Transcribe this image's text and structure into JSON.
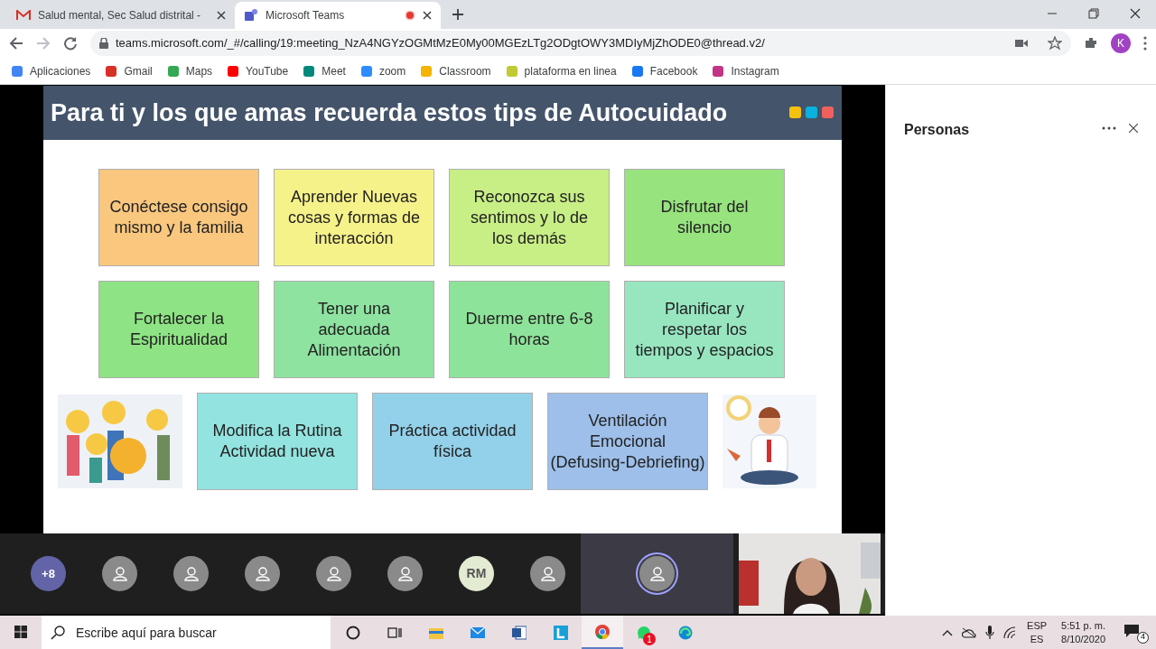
{
  "tabs": [
    {
      "title": "Salud mental, Sec Salud distrital -",
      "selected": false,
      "recording": false
    },
    {
      "title": "Microsoft Teams",
      "selected": true,
      "recording": true
    }
  ],
  "url": "teams.microsoft.com/_#/calling/19:meeting_NzA4NGYzOGMtMzE0My00MGEzLTg2ODgtOWY3MDIyMjZhODE0@thread.v2/",
  "profile": "K",
  "bookmarks": [
    {
      "label": "Aplicaciones",
      "color": "#4285f4"
    },
    {
      "label": "Gmail",
      "color": "#d93025"
    },
    {
      "label": "Maps",
      "color": "#34a853"
    },
    {
      "label": "YouTube",
      "color": "#ff0000"
    },
    {
      "label": "Meet",
      "color": "#00897b"
    },
    {
      "label": "zoom",
      "color": "#2d8cff"
    },
    {
      "label": "Classroom",
      "color": "#f4b400"
    },
    {
      "label": "plataforma en linea",
      "color": "#c0ca33"
    },
    {
      "label": "Facebook",
      "color": "#1877f2"
    },
    {
      "label": "Instagram",
      "color": "#c13584"
    }
  ],
  "slide": {
    "title": "Para ti y los que amas recuerda estos tips de Autocuidado",
    "rows": [
      [
        {
          "kind": "tip",
          "text": "Conéctese consigo\nmismo y  la familia",
          "color": "#f9c77e"
        },
        {
          "kind": "tip",
          "text": "Aprender Nuevas\ncosas y formas de\ninteracción",
          "color": "#f6f28a"
        },
        {
          "kind": "tip",
          "text": "Reconozca  sus\nsentimos y lo de\nlos demás",
          "color": "#c8ee86"
        },
        {
          "kind": "tip",
          "text": "Disfrutar del\nsilencio",
          "color": "#97e37e"
        }
      ],
      [
        {
          "kind": "tip",
          "text": "Fortalecer la\nEspiritualidad",
          "color": "#8ee384"
        },
        {
          "kind": "tip",
          "text": "Tener una\nadecuada\nAlimentación",
          "color": "#8ee3a0"
        },
        {
          "kind": "tip",
          "text": "Duerme entre 6-8\nhoras",
          "color": "#8ee39a"
        },
        {
          "kind": "tip",
          "text": "Planificar y\nrespetar los\ntiempos y espacios",
          "color": "#97e6c0"
        }
      ],
      [
        {
          "kind": "picture"
        },
        {
          "kind": "tip",
          "text": "Modifica la Rutina\nActividad nueva",
          "color": "#93e3e0"
        },
        {
          "kind": "tip",
          "text": "Práctica actividad\nfísica",
          "color": "#93d0ea"
        },
        {
          "kind": "tip",
          "text": "Ventilación\nEmocional\n(Defusing-Debriefing)",
          "color": "#9dbfe9"
        },
        {
          "kind": "picture"
        }
      ]
    ]
  },
  "panel": {
    "title": "Personas"
  },
  "participants": [
    {
      "kind": "overflow",
      "label": "+8",
      "selected": false
    },
    {
      "kind": "avatar",
      "selected": false
    },
    {
      "kind": "avatar",
      "selected": false
    },
    {
      "kind": "avatar",
      "selected": false
    },
    {
      "kind": "avatar",
      "selected": false
    },
    {
      "kind": "avatar",
      "selected": false
    },
    {
      "kind": "initials",
      "label": "RM",
      "selected": false
    },
    {
      "kind": "avatar",
      "selected": false
    },
    {
      "kind": "avatar",
      "selected": true
    }
  ],
  "taskbar": {
    "search": {
      "placeholder": "Escribe aquí para buscar"
    },
    "apps": [
      {
        "kind": "cortana",
        "active": false
      },
      {
        "kind": "taskview",
        "active": false
      },
      {
        "kind": "folder",
        "active": false
      },
      {
        "kind": "mail",
        "active": false
      },
      {
        "kind": "word",
        "active": false
      },
      {
        "kind": "l",
        "active": false
      },
      {
        "kind": "chrome",
        "active": true
      },
      {
        "kind": "whatsapp",
        "active": false,
        "badge": "1"
      },
      {
        "kind": "edge",
        "active": false
      }
    ],
    "language": "ESP",
    "layout": "ES",
    "time": "5:51 p. m.",
    "date": "8/10/2020",
    "notifications": "4"
  }
}
